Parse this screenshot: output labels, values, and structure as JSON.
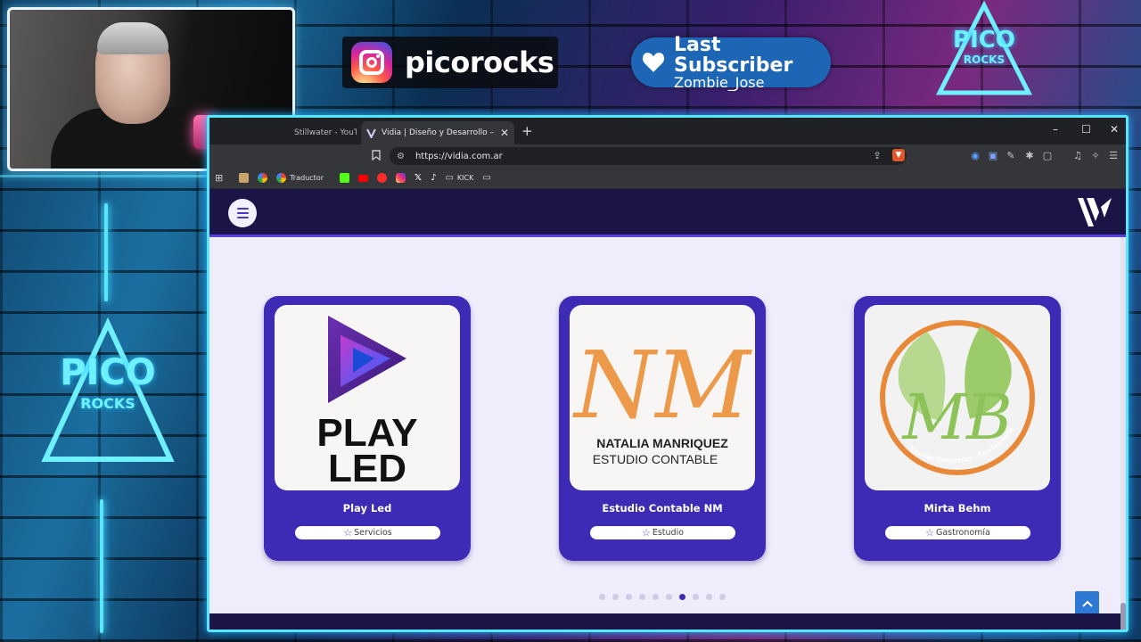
{
  "overlay": {
    "instagram_handle": "picorocks",
    "subscriber_title": "Last Subscriber",
    "subscriber_name": "Zombie_Jose",
    "logo_word": "PICO",
    "logo_sub": "ROCKS"
  },
  "browser": {
    "tabs": [
      {
        "label": "Stillwater - YouTu",
        "active": false
      },
      {
        "label": "Vidia | Diseño y Desarrollo – dise",
        "active": true
      }
    ],
    "new_tab": "+",
    "window_controls": [
      "–",
      "☐",
      "✕"
    ],
    "url": "https://vidia.com.ar",
    "bookmarks": [
      {
        "label": "",
        "icon": "apps-icon",
        "color": "#cfcfcf"
      },
      {
        "label": "",
        "icon": "folder-image-icon",
        "color": "#c9a36a"
      },
      {
        "label": "",
        "icon": "google-icon",
        "color": "#ffffff"
      },
      {
        "label": "Traductor",
        "icon": "google-translate-icon",
        "color": "#4285f4"
      },
      {
        "label": "",
        "icon": "kick-icon",
        "color": "#53fc18"
      },
      {
        "label": "",
        "icon": "youtube-icon",
        "color": "#ff0000"
      },
      {
        "label": "",
        "icon": "youtube-music-icon",
        "color": "#ff2a2a"
      },
      {
        "label": "",
        "icon": "instagram-icon",
        "color": "#d6249f"
      },
      {
        "label": "",
        "icon": "x-icon",
        "color": "#ffffff"
      },
      {
        "label": "",
        "icon": "tiktok-icon",
        "color": "#111111"
      },
      {
        "label": "KICK",
        "icon": "folder-icon",
        "color": "#cfcfcf"
      },
      {
        "label": "",
        "icon": "folder-icon",
        "color": "#cfcfcf"
      }
    ]
  },
  "site": {
    "cards": [
      {
        "title": "Play Led",
        "tag": "Servicios",
        "logo_text": [
          "PLAY",
          "LED"
        ]
      },
      {
        "title": "Estudio Contable NM",
        "tag": "Estudio",
        "logo_text": [
          "NATALIA MANRIQUEZ",
          "ESTUDIO CONTABLE"
        ],
        "monogram": "NM"
      },
      {
        "title": "Mirta Behm",
        "tag": "Gastronomía",
        "logo_text": [
          "Viandas Saludables - Sandwichería"
        ],
        "monogram": "MB"
      }
    ],
    "pagination": {
      "total": 10,
      "active_index": 6
    },
    "colors": {
      "header": "#1b1547",
      "card": "#3e2bb5",
      "page_bg": "#efedfb",
      "accent": "#5a3de0",
      "scroll_top": "#2e79d5"
    }
  }
}
